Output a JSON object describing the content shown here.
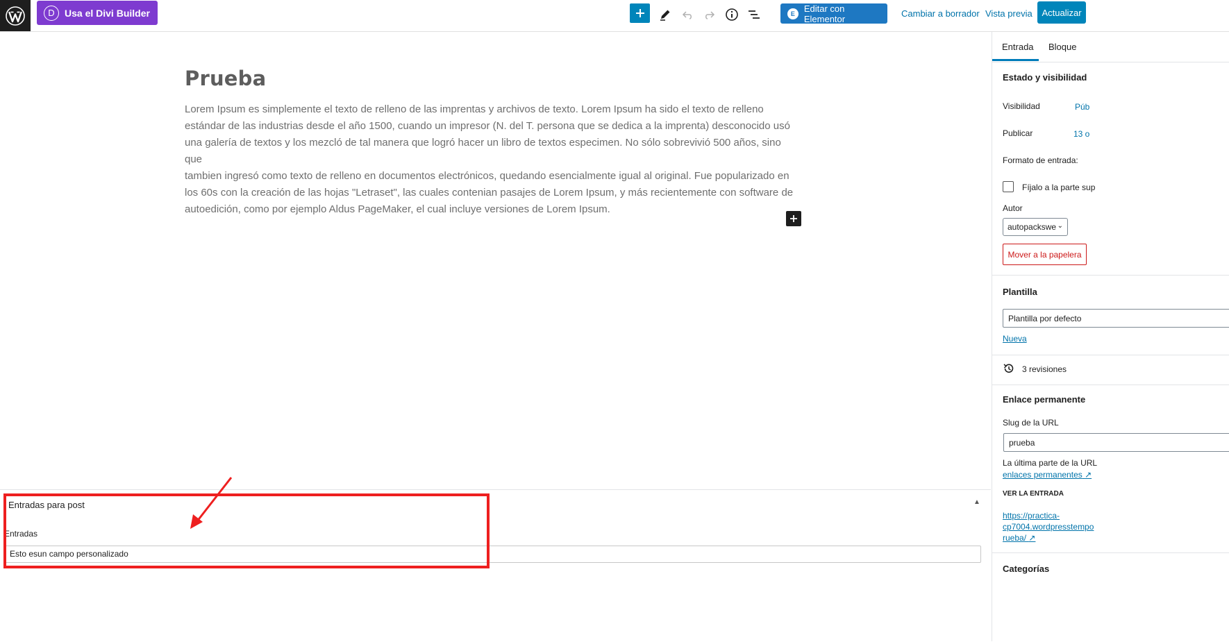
{
  "topbar": {
    "divi_label": "Usa el Divi Builder",
    "divi_logo_letter": "D",
    "elementor_label": "Editar con Elementor",
    "elementor_logo": "E",
    "switch_draft": "Cambiar a borrador",
    "preview": "Vista previa",
    "update": "Actualizar",
    "icons": [
      "wordpress-icon",
      "plus-icon",
      "pencil-icon",
      "undo-icon",
      "redo-icon",
      "info-icon",
      "list-view-icon"
    ]
  },
  "editor": {
    "title": "Prueba",
    "body": "Lorem Ipsum es simplemente el texto de relleno de las imprentas y archivos de texto. Lorem Ipsum ha sido el texto de relleno\nestándar de las industrias desde el año 1500, cuando un impresor (N. del T. persona que se dedica a la imprenta) desconocido usó\nuna galería de textos y los mezcló de tal manera que logró hacer un libro de textos especimen. No sólo sobrevivió 500 años, sino que\ntambien ingresó como texto de relleno en documentos electrónicos, quedando esencialmente igual al original. Fue popularizado en\nlos 60s con la creación de las hojas \"Letraset\", las cuales contenian pasajes de Lorem Ipsum, y más recientemente con software de\nautoedición, como por ejemplo Aldus PageMaker, el cual incluye versiones de Lorem Ipsum."
  },
  "metabox": {
    "title": "Entradas para post",
    "field_label": "Entradas",
    "field_value": "Esto esun campo personalizado"
  },
  "sidebar": {
    "tabs": [
      "Entrada",
      "Bloque"
    ],
    "status_heading": "Estado y visibilidad",
    "visibility_label": "Visibilidad",
    "visibility_value": "Púb",
    "publish_label": "Publicar",
    "publish_value": "13 o",
    "format_label": "Formato de entrada:",
    "sticky_label": "Fíjalo a la parte sup",
    "author_label": "Autor",
    "author_value": "autopackswe",
    "trash_label": "Mover a la papelera",
    "template_heading": "Plantilla",
    "template_value": "Plantilla por defecto",
    "template_new": "Nueva",
    "revisions": "3 revisiones",
    "permalink_heading": "Enlace permanente",
    "slug_label": "Slug de la URL",
    "slug_value": "prueba",
    "slug_help": "La última parte de la URL",
    "permalink_link": "enlaces permanentes",
    "view_entry_label": "VER LA ENTRADA",
    "url_line1": "https://practica-",
    "url_line2": "cp7004.wordpresstempo",
    "url_line3": "rueba/",
    "categories_heading": "Categorías"
  },
  "colors": {
    "accent": "#0085ba",
    "divi": "#7e3bd0",
    "elementor": "#1e78c2",
    "annotation": "#ee1f1f",
    "danger": "#cc1818"
  }
}
